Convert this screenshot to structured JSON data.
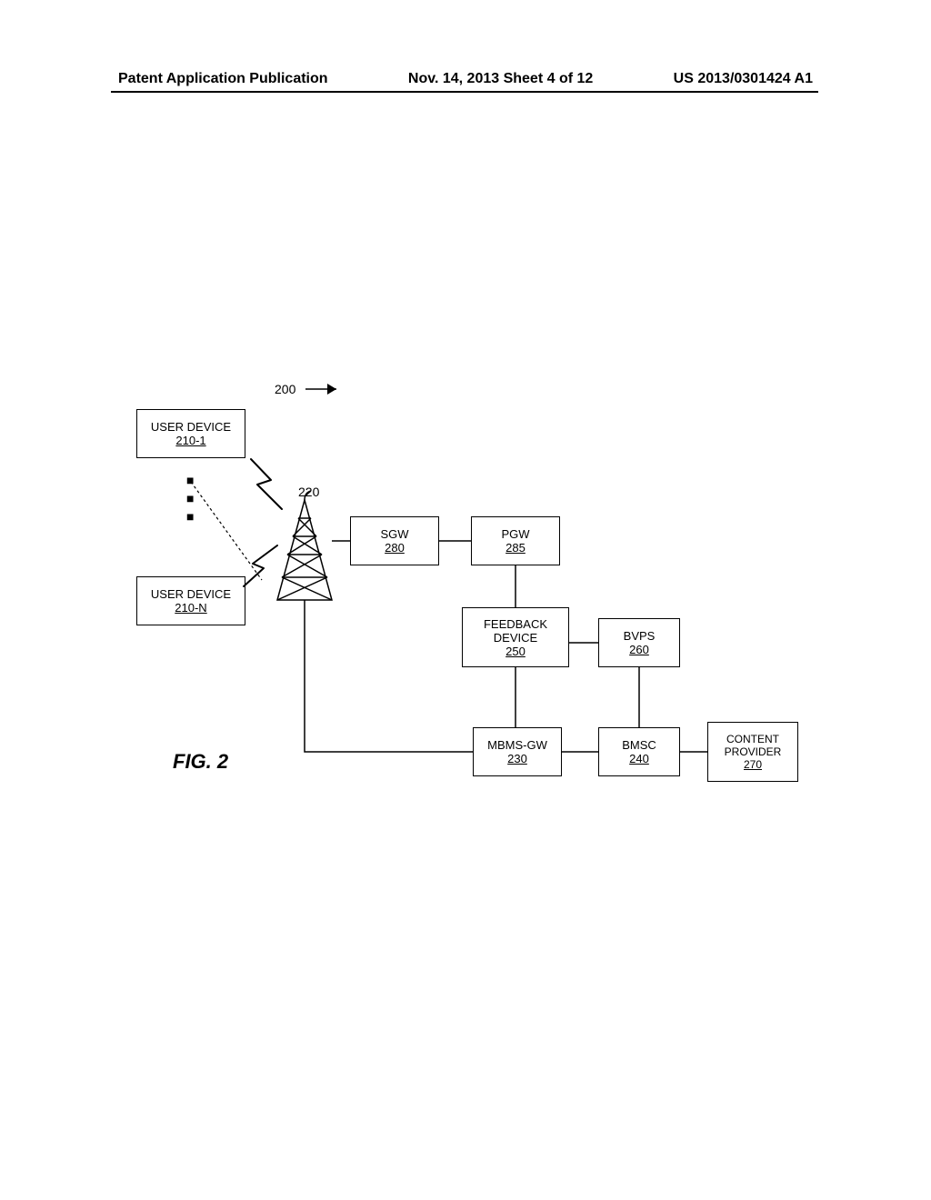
{
  "header": {
    "left": "Patent Application Publication",
    "center": "Nov. 14, 2013  Sheet 4 of 12",
    "right": "US 2013/0301424 A1"
  },
  "diagram": {
    "system_ref": "200",
    "tower_ref": "220",
    "fig_label": "FIG. 2",
    "nodes": {
      "user_device_1": {
        "label": "USER DEVICE",
        "id": "210-1"
      },
      "user_device_n": {
        "label": "USER DEVICE",
        "id": "210-N"
      },
      "sgw": {
        "label": "SGW",
        "id": "280"
      },
      "pgw": {
        "label": "PGW",
        "id": "285"
      },
      "feedback": {
        "label": "FEEDBACK\nDEVICE",
        "id": "250"
      },
      "bvps": {
        "label": "BVPS",
        "id": "260"
      },
      "mbms_gw": {
        "label": "MBMS-GW",
        "id": "230"
      },
      "bmsc": {
        "label": "BMSC",
        "id": "240"
      },
      "content_provider": {
        "label": "CONTENT\nPROVIDER",
        "id": "270"
      }
    }
  }
}
